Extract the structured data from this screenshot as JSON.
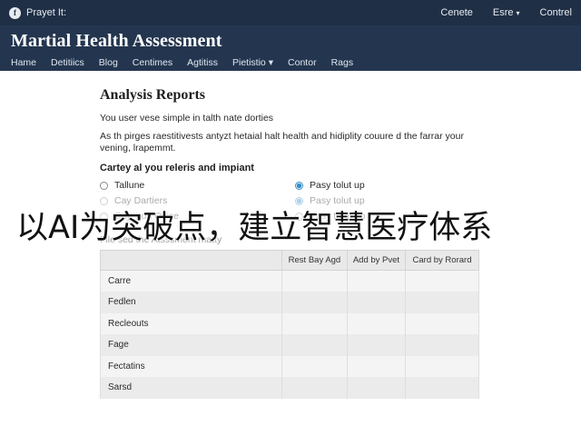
{
  "topbar": {
    "brand_icon": "f",
    "brand_label": "Prayet It:",
    "links": [
      "Cenete",
      "Esre",
      "Contrel"
    ]
  },
  "header": {
    "title": "Martial Health Assessment",
    "nav": [
      "Hame",
      "Detitiics",
      "Blog",
      "Centimes",
      "Agtitiss",
      "Pietistio",
      "Contor",
      "Rags"
    ]
  },
  "main": {
    "heading": "Analysis Reports",
    "intro": "You user vese simple in talth nate dorties",
    "description": "As th pirges raestitivests antyzt hetaial halt health and hidiplity couure d the farrar your vening, lrapemmt.",
    "options_label": "Cartey al you releris and impiant",
    "options": [
      {
        "label": "Tallune",
        "checked": false
      },
      {
        "label": "Pasy tolut up",
        "checked": true
      },
      {
        "label": "Cay Dartiers",
        "checked": false
      },
      {
        "label": "Pasy tolut up",
        "checked": true
      },
      {
        "label": "Cay, pon Oltice",
        "checked": false
      },
      {
        "label": "Pasy totut up",
        "checked": false
      }
    ],
    "table_caption": "File sed the Atsssment matty",
    "table": {
      "headers": [
        "",
        "Rest Bay Agd",
        "Add by Pvet",
        "Card by Rorard"
      ],
      "rows": [
        "Carre",
        "Fedlen",
        "Recleouts",
        "Fage",
        "Fectatins",
        "Sarsd"
      ]
    }
  },
  "overlay": {
    "text": "以AI为突破点，建立智慧医疗体系"
  }
}
